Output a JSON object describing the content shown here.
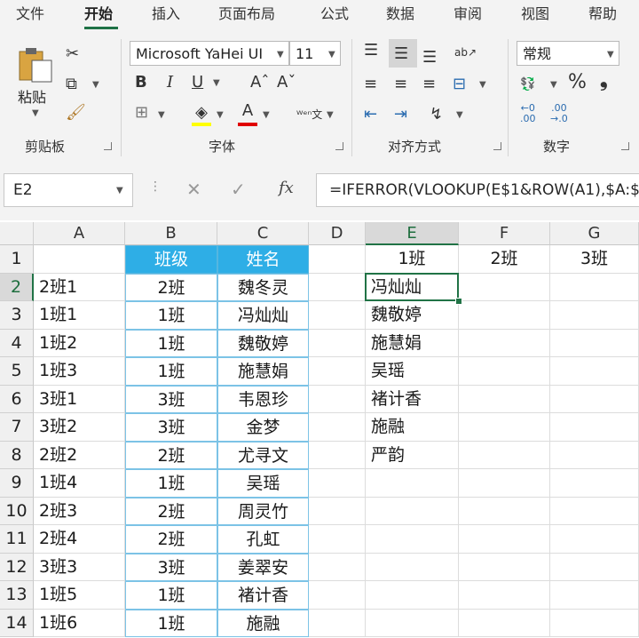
{
  "menu": {
    "tabs": [
      "文件",
      "开始",
      "插入",
      "页面布局",
      "公式",
      "数据",
      "审阅",
      "视图",
      "帮助"
    ],
    "active": 1
  },
  "ribbon": {
    "clipboard": {
      "paste_label": "粘贴",
      "group_label": "剪贴板"
    },
    "font": {
      "font_name": "Microsoft YaHei UI",
      "font_size": "11",
      "group_label": "字体",
      "bold": "B",
      "italic": "I",
      "underline": "U"
    },
    "alignment": {
      "group_label": "对齐方式"
    },
    "number": {
      "format": "常规",
      "group_label": "数字"
    }
  },
  "formula_bar": {
    "name_box": "E2",
    "formula": "=IFERROR(VLOOKUP(E$1&ROW(A1),$A:$"
  },
  "colors": {
    "accent": "#217346",
    "table_header": "#2eaee6",
    "table_border": "#7cc3e6"
  },
  "grid": {
    "columns": [
      "A",
      "B",
      "C",
      "D",
      "E",
      "F",
      "G"
    ],
    "selected_col": "E",
    "selected_row": "2",
    "rows": [
      {
        "n": "1",
        "A": "",
        "B": "班级",
        "C": "姓名",
        "E": "1班",
        "F": "2班",
        "G": "3班"
      },
      {
        "n": "2",
        "A": "2班1",
        "B": "2班",
        "C": "魏冬灵",
        "E": "冯灿灿"
      },
      {
        "n": "3",
        "A": "1班1",
        "B": "1班",
        "C": "冯灿灿",
        "E": "魏敬婷"
      },
      {
        "n": "4",
        "A": "1班2",
        "B": "1班",
        "C": "魏敬婷",
        "E": "施慧娟"
      },
      {
        "n": "5",
        "A": "1班3",
        "B": "1班",
        "C": "施慧娟",
        "E": "吴瑶"
      },
      {
        "n": "6",
        "A": "3班1",
        "B": "3班",
        "C": "韦恩珍",
        "E": "褚计香"
      },
      {
        "n": "7",
        "A": "3班2",
        "B": "3班",
        "C": "金梦",
        "E": "施融"
      },
      {
        "n": "8",
        "A": "2班2",
        "B": "2班",
        "C": "尤寻文",
        "E": "严韵"
      },
      {
        "n": "9",
        "A": "1班4",
        "B": "1班",
        "C": "吴瑶",
        "E": ""
      },
      {
        "n": "10",
        "A": "2班3",
        "B": "2班",
        "C": "周灵竹",
        "E": ""
      },
      {
        "n": "11",
        "A": "2班4",
        "B": "2班",
        "C": "孔虹",
        "E": ""
      },
      {
        "n": "12",
        "A": "3班3",
        "B": "3班",
        "C": "姜翠安",
        "E": ""
      },
      {
        "n": "13",
        "A": "1班5",
        "B": "1班",
        "C": "褚计香",
        "E": ""
      },
      {
        "n": "14",
        "A": "1班6",
        "B": "1班",
        "C": "施融",
        "E": ""
      }
    ]
  }
}
